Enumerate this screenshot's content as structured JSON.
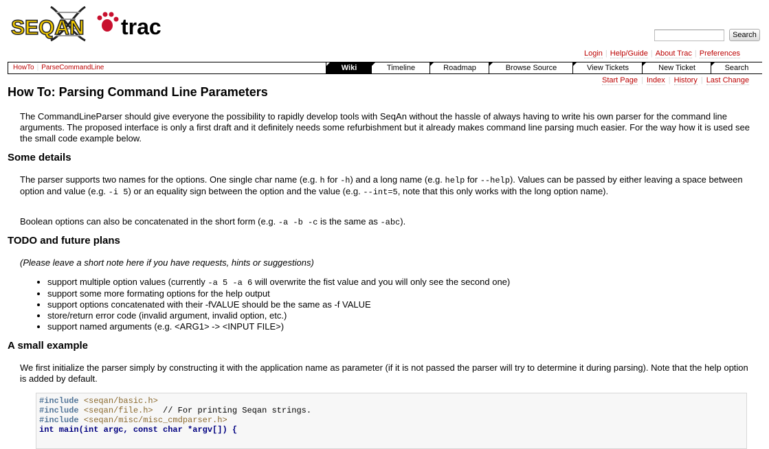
{
  "logo": {
    "text_seqan": "SEQAN",
    "text_trac": "trac"
  },
  "search": {
    "placeholder": "",
    "button_label": "Search"
  },
  "metanav": [
    "Login",
    "Help/Guide",
    "About Trac",
    "Preferences"
  ],
  "breadcrumb": [
    "HowTo",
    "ParseCommandLine"
  ],
  "mainnav": [
    {
      "label": "Wiki",
      "active": true
    },
    {
      "label": "Timeline",
      "active": false
    },
    {
      "label": "Roadmap",
      "active": false
    },
    {
      "label": "Browse Source",
      "active": false
    },
    {
      "label": "View Tickets",
      "active": false
    },
    {
      "label": "New Ticket",
      "active": false
    },
    {
      "label": "Search",
      "active": false
    }
  ],
  "ctxnav": [
    "Start Page",
    "Index",
    "History",
    "Last Change"
  ],
  "page": {
    "title": "How To: Parsing Command Line Parameters",
    "intro": "The CommandLineParser should give everyone the possibility to rapidly develop tools with SeqAn without the hassle of always having to write his own parser for the command line arguments. The proposed interface is only a first draft and it definitely needs some refurbishment but it already makes command line parsing much easier. For the way how it is used see the small code example below.",
    "h_details": "Some details",
    "details_1a": "The parser supports two names for the options. One single char name (e.g. ",
    "details_1_h": "h",
    "details_1b": " for ",
    "details_1_dh": "-h",
    "details_1c": ") and a long name (e.g. ",
    "details_1_help": "help",
    "details_1d": " for ",
    "details_1_dhelp": "--help",
    "details_1e": "). Values can be passed by either leaving a space between option and value (e.g. ",
    "details_1_i5": "-i 5",
    "details_1f": ") or an equality sign between the option and the value (e.g. ",
    "details_1_int": "--int=5",
    "details_1g": ", note that this only works with the long option name).",
    "details_2a": "Boolean options can also be concatenated in the short form (e.g. ",
    "details_2_code": "-a -b -c",
    "details_2b": " is the same as ",
    "details_2_abc": "-abc",
    "details_2c": ").",
    "h_todo": "TODO and future plans",
    "todo_note": "(Please leave a short note here if you have requests, hints or suggestions)",
    "todo_1a": "support multiple option values (currently ",
    "todo_1_code": "-a 5 -a 6",
    "todo_1b": " will overwrite the fist value and you will only see the second one)",
    "todo_2": "support some more formating options for the help output",
    "todo_3": "support options concatenated with their -fVALUE should be the same as -f VALUE",
    "todo_4": "store/return error code (invalid argument, invalid option, etc.)",
    "todo_5": "support named arguments (e.g. <ARG1> -> <INPUT FILE>)",
    "h_example": "A small example",
    "example_intro": "We first initialize the parser simply by constructing it with the application name as parameter (if it is not passed the parser will try to determine it during parsing). Note that the help option is added by default.",
    "code": {
      "l1_pp": "#include",
      "l1_str": "<seqan/basic.h>",
      "l2_pp": "#include",
      "l2_str": "<seqan/file.h>",
      "l2_comment": "  // For printing Seqan strings.",
      "l3_pp": "#include",
      "l3_str": "<seqan/misc/misc_cmdparser.h>",
      "l4": "int main(int argc, const char *argv[]) {"
    }
  }
}
